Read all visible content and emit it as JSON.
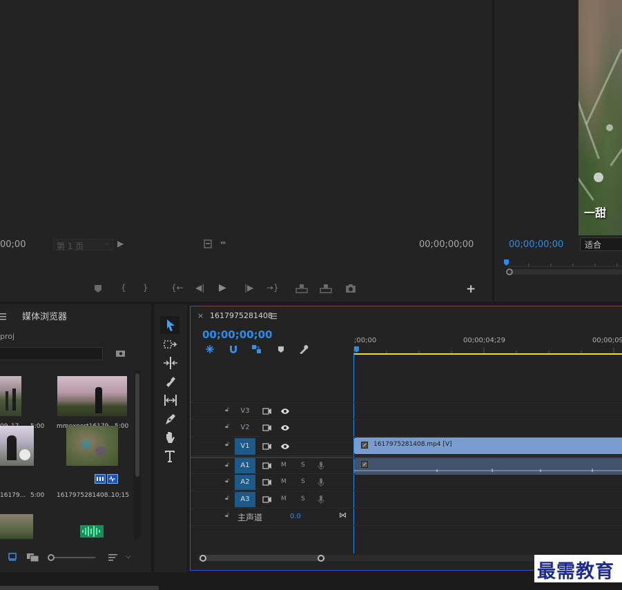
{
  "source_monitor": {
    "timecode_left": "00;00",
    "page_select": "第 1 页",
    "timecode_right": "00;00;00;00"
  },
  "program_monitor": {
    "timecode": "00;00;00;00",
    "fit_select": "适合",
    "subtitle_fragment": "一甜"
  },
  "project_panel": {
    "tab_label": "媒体浏览器",
    "path_fragment": "proj",
    "items": [
      {
        "name": "09_17...",
        "duration": "5:00"
      },
      {
        "name": "mmexport16179...",
        "duration": "5:00"
      },
      {
        "name": "16179...",
        "duration": "5:00"
      },
      {
        "name": "1617975281408...",
        "duration": "10;15"
      }
    ]
  },
  "timeline": {
    "sequence_name": "1617975281408",
    "timecode": "00;00;00;00",
    "ruler_labels": [
      ";00;00",
      "00;00;04;29",
      "00;00;09"
    ],
    "tracks_video": [
      "V3",
      "V2",
      "V1"
    ],
    "tracks_audio": [
      "A1",
      "A2",
      "A3"
    ],
    "mute_label": "M",
    "solo_label": "S",
    "master_label": "主声道",
    "master_value": "0.0",
    "clip_label": "1617975281408.mp4 [V]"
  },
  "watermark": "最需教育",
  "colors": {
    "accent_blue": "#2d8ceb",
    "playhead_yellow": "#e8e800",
    "clip_blue": "#7b9ccf",
    "panel_bg": "#232323"
  }
}
